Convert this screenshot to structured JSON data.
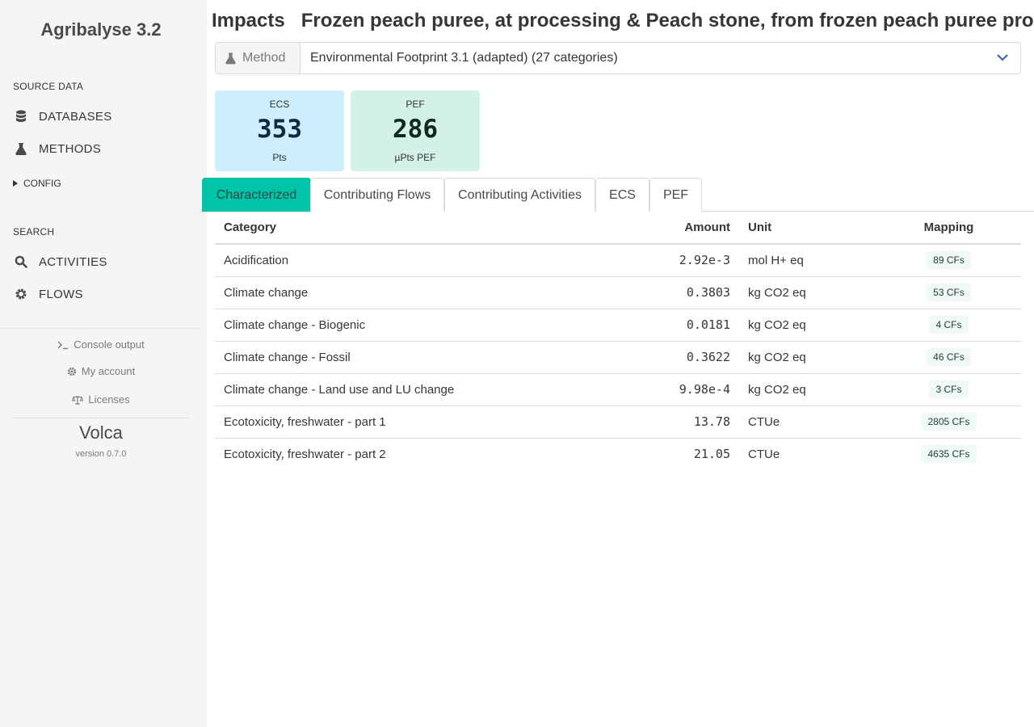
{
  "sidebar": {
    "app_title": "Agribalyse 3.2",
    "source_data_label": "SOURCE DATA",
    "items_source": [
      {
        "label": "DATABASES",
        "icon": "database-icon"
      },
      {
        "label": "METHODS",
        "icon": "flask-icon"
      }
    ],
    "config_label": "CONFIG",
    "search_label": "SEARCH",
    "items_search": [
      {
        "label": "ACTIVITIES",
        "icon": "search-icon"
      },
      {
        "label": "FLOWS",
        "icon": "gear-icon"
      }
    ],
    "footer": {
      "console": "Console output",
      "account": "My account",
      "licenses": "Licenses",
      "brand": "Volca",
      "version": "version 0.7.0"
    }
  },
  "header": {
    "title": "Impacts",
    "subtitle": "Frozen peach puree, at processing & Peach stone, from frozen peach puree processing"
  },
  "method": {
    "addon_label": "Method",
    "selected": "Environmental Footprint 3.1 (adapted) (27 categories)"
  },
  "scores": {
    "ecs": {
      "label": "ECS",
      "value": "353",
      "unit": "Pts"
    },
    "pef": {
      "label": "PEF",
      "value": "286",
      "unit": "µPts PEF"
    }
  },
  "tabs": [
    {
      "label": "Characterized",
      "active": true
    },
    {
      "label": "Contributing Flows",
      "active": false
    },
    {
      "label": "Contributing Activities",
      "active": false
    },
    {
      "label": "ECS",
      "active": false
    },
    {
      "label": "PEF",
      "active": false
    }
  ],
  "table": {
    "headers": {
      "category": "Category",
      "amount": "Amount",
      "unit": "Unit",
      "mapping": "Mapping"
    },
    "rows": [
      {
        "category": "Acidification",
        "amount": "2.92e-3",
        "unit": "mol H+ eq",
        "mapping": "89 CFs"
      },
      {
        "category": "Climate change",
        "amount": "0.3803",
        "unit": "kg CO2 eq",
        "mapping": "53 CFs"
      },
      {
        "category": "Climate change - Biogenic",
        "amount": "0.0181",
        "unit": "kg CO2 eq",
        "mapping": "4 CFs"
      },
      {
        "category": "Climate change - Fossil",
        "amount": "0.3622",
        "unit": "kg CO2 eq",
        "mapping": "46 CFs"
      },
      {
        "category": "Climate change - Land use and LU change",
        "amount": "9.98e-4",
        "unit": "kg CO2 eq",
        "mapping": "3 CFs"
      },
      {
        "category": "Ecotoxicity, freshwater - part 1",
        "amount": "13.78",
        "unit": "CTUe",
        "mapping": "2805 CFs"
      },
      {
        "category": "Ecotoxicity, freshwater - part 2",
        "amount": "21.05",
        "unit": "CTUe",
        "mapping": "4635 CFs"
      }
    ]
  },
  "colors": {
    "accent": "#00c4a7",
    "ecs_bg": "#cdeefd",
    "pef_bg": "#d3f1e4",
    "sidebar_bg": "#f5f5f5"
  }
}
